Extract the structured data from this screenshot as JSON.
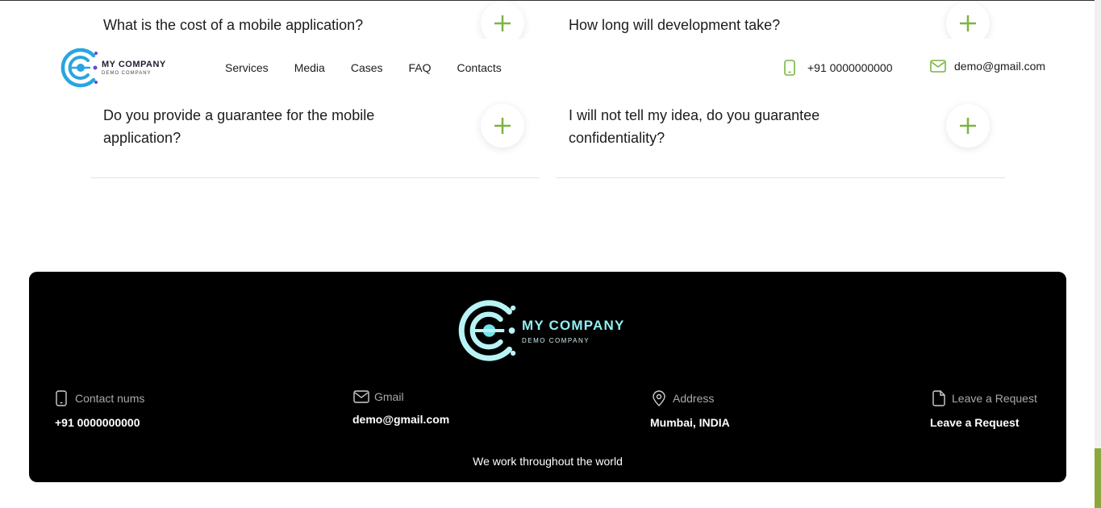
{
  "faq": {
    "items": [
      {
        "question": "What is the cost of a mobile application?"
      },
      {
        "question": "How long will development take?"
      },
      {
        "question": "Do you provide a guarantee for the mobile application?"
      },
      {
        "question": "I will not tell my idea, do you guarantee confidentiality?"
      }
    ]
  },
  "header": {
    "logo": {
      "name": "MY COMPANY",
      "sub": "DEMO COMPANY"
    },
    "nav": [
      "Services",
      "Media",
      "Cases",
      "FAQ",
      "Contacts"
    ],
    "phone": "+91 0000000000",
    "email": "demo@gmail.com"
  },
  "footer": {
    "logo": {
      "name": "MY COMPANY",
      "sub": "DEMO COMPANY"
    },
    "columns": [
      {
        "label": "Contact nums",
        "value": "+91 0000000000",
        "icon": "phone-icon"
      },
      {
        "label": "Gmail",
        "value": "demo@gmail.com",
        "icon": "mail-icon"
      },
      {
        "label": "Address",
        "value": "Mumbai, INDIA",
        "icon": "location-pin-icon"
      },
      {
        "label": "Leave a Request",
        "value": "Leave a Request",
        "icon": "document-icon"
      }
    ],
    "tagline": "We work throughout the world"
  },
  "colors": {
    "accent_green": "#7cb342",
    "logo_blue": "#2aa5e0",
    "footer_cyan": "#8ef0f4",
    "footer_bg": "#000000"
  }
}
